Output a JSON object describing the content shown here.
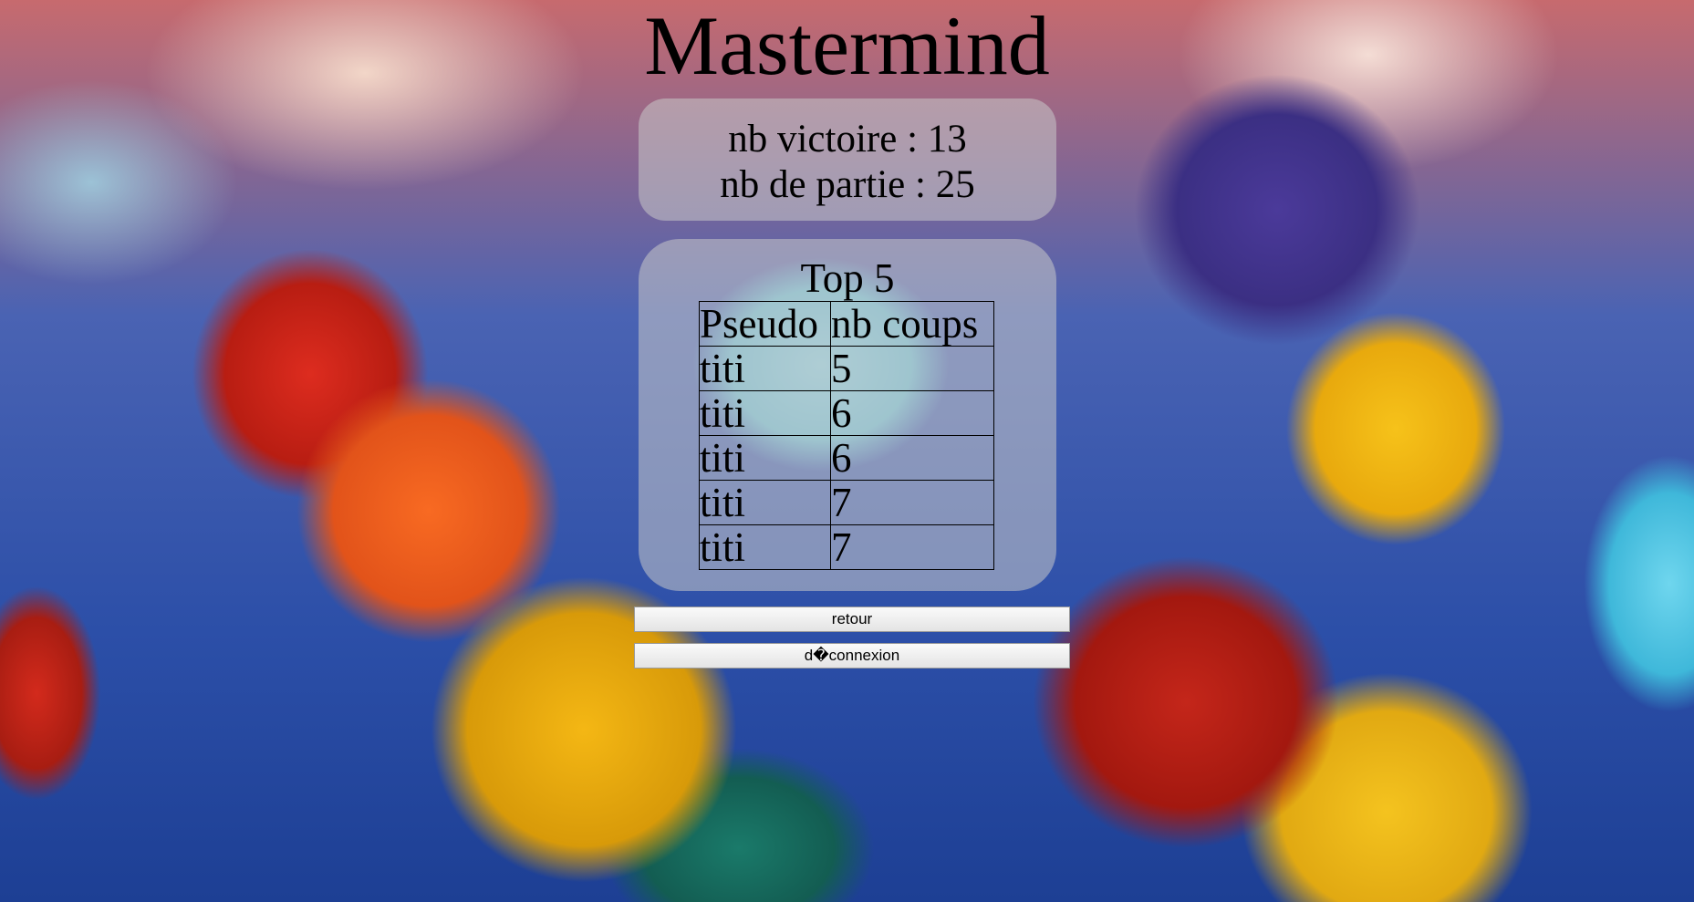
{
  "title": "Mastermind",
  "stats": {
    "victories_label": "nb victoire : 13",
    "games_label": "nb de partie : 25"
  },
  "leaderboard": {
    "title": "Top 5",
    "columns": [
      "Pseudo",
      "nb coups"
    ],
    "rows": [
      {
        "pseudo": "titi",
        "coups": "5"
      },
      {
        "pseudo": "titi",
        "coups": "6"
      },
      {
        "pseudo": "titi",
        "coups": "6"
      },
      {
        "pseudo": "titi",
        "coups": "7"
      },
      {
        "pseudo": "titi",
        "coups": "7"
      }
    ]
  },
  "buttons": {
    "back_label": "retour",
    "logout_label": "d�connexion"
  }
}
